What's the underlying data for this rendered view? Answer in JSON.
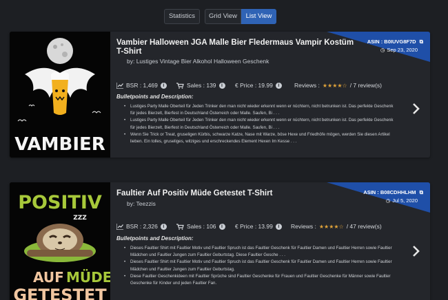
{
  "toolbar": {
    "statistics": "Statistics",
    "grid_view": "Grid View",
    "list_view": "List View"
  },
  "cards": [
    {
      "title_line1": "Vambier Halloween JGA Malle Bier Fledermaus Vampir Kostüm",
      "title_line2": "T-Shirt",
      "by": "by: Lustiges Vintage Bier Alkohol Halloween Geschenk",
      "asin": "ASIN : B0IUVG8F7D",
      "date": "Sep 23, 2020",
      "bsr": "BSR : 1,469",
      "sales": "Sales : 139",
      "price": "€ Price : 19.99",
      "reviews_label": "Reviews :",
      "stars": "★★★★☆",
      "reviews_count": "/ 7 review(s)",
      "bp_title": "Bulletpoints and Description:",
      "thumb_text": "VAMBIER",
      "bullets": [
        "Lustiges Party Malle Oberteil für Jeden Trinker den man nicht wieder erkennt wenn er nüchtern, nicht betrunken ist. Das perfekte Geschenk für jedes Bierzelt, Bierfest in Deutschland Österreich oder Malle. Saufen, Bi . . .",
        "Lustiges Party Malle Oberteil für Jeden Trinker den man nicht wieder erkennt wenn er nüchtern, nicht betrunken ist. Das perfekte Geschenk für jedes Bierzelt, Bierfest in Deutschland Österreich oder Malle. Saufen, Bi . . .",
        "Wenn Sie Trick or Treat, gruseligen Kürbis, schwarze Katze, Nase mit Warze, böse Hexe und Friedhöfe mögen, werden Sie diesen Artikel lieben. Ein tolles, gruseliges, witziges und erschreckendes Element Hexen Im Kesse . . ."
      ]
    },
    {
      "title_line1": "Faultier Auf Positiv Müde Getestet T-Shirt",
      "by": "by: Teezzis",
      "asin": "ASIN : B08CDHHLHM",
      "date": "Jul 5, 2020",
      "bsr": "BSR : 2,326",
      "sales": "Sales : 106",
      "price": "€ Price : 13.99",
      "reviews_label": "Reviews :",
      "stars": "★★★★☆",
      "reviews_count": "/ 47 review(s)",
      "bp_title": "Bulletpoints and Description:",
      "thumb_line1": "POSITIV",
      "thumb_line2a": "AUF",
      "thumb_line2b": "MÜDE",
      "thumb_line3": "GETESTET",
      "thumb_zzz": "ZZZ",
      "bullets": [
        "Dieses Faultier Shirt mit Faultier Motiv und Faultier Spruch ist das Faultier Geschenk für Faultier Damen und Faultier Herren sowie Faultier Mädchen und Faultier Jungen zum Faultier Geburtstag. Diese Faultier Gesche . . .",
        "Dieses Faultier Shirt mit Faultier Motiv und Faultier Spruch ist das Faultier Geschenk für Faultier Damen und Faultier Herren sowie Faultier Mädchen und Faultier Jungen zum Faultier Geburtstag.",
        "Diese Faultier Geschenkideen mit Faultier Sprüche sind Faultier Geschenke für Frauen und Faultier Geschenke für Männer sowie Faultier Geschenke für Kinder und jeden Faultier Fan."
      ]
    }
  ],
  "colors": {
    "background": "#1d1f23",
    "card": "#24262b",
    "accent_blue": "#2f63b5",
    "corner_blue": "#1f4fa8",
    "stars": "#e0a33a"
  }
}
